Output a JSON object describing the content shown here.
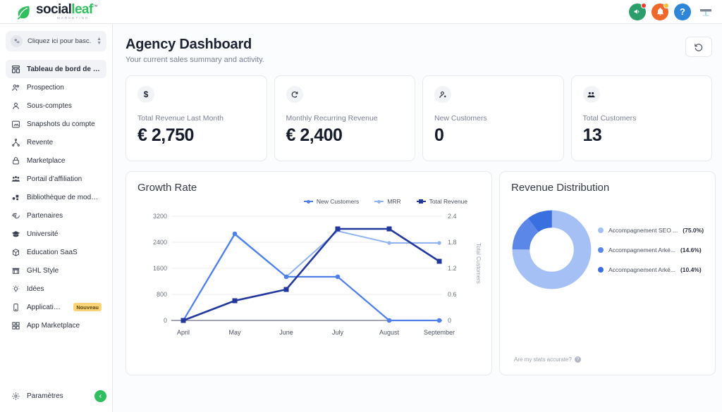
{
  "brand": {
    "name_part1": "social",
    "name_part2": "leaf",
    "tm": "™",
    "tagline": "MARKETING",
    "leaf_icon": "leaf-icon"
  },
  "topbar": {
    "icons": [
      {
        "name": "announcement-megaphone-icon",
        "badge": "red"
      },
      {
        "name": "notification-bell-icon",
        "badge": "yellow"
      },
      {
        "name": "help-question-icon",
        "label": "?"
      },
      {
        "name": "user-avatar",
        "label": ""
      }
    ]
  },
  "sidebar": {
    "switcher": {
      "icon": "switch-account-icon",
      "text": "Cliquez ici pour basc...",
      "stepper_icon": "chevron-updown-icon"
    },
    "items": [
      {
        "label": "Tableau de bord de l’Age...",
        "icon": "dashboard-icon",
        "active": true
      },
      {
        "label": "Prospection",
        "icon": "prospecting-users-icon",
        "active": false
      },
      {
        "label": "Sous-comptes",
        "icon": "subaccount-user-icon",
        "active": false
      },
      {
        "label": "Snapshots du compte",
        "icon": "snapshot-image-icon",
        "active": false
      },
      {
        "label": "Revente",
        "icon": "reseller-network-icon",
        "active": false
      },
      {
        "label": "Marketplace",
        "icon": "lock-marketplace-icon",
        "active": false
      },
      {
        "label": "Portail d’affiliation",
        "icon": "affiliate-group-icon",
        "active": false
      },
      {
        "label": "Bibliothèque de modèles",
        "icon": "template-library-icon",
        "active": false
      },
      {
        "label": "Partenaires",
        "icon": "partners-handshake-icon",
        "active": false
      },
      {
        "label": "Université",
        "icon": "graduation-cap-icon",
        "active": false
      },
      {
        "label": "Éducation SaaS",
        "icon": "saas-education-icon",
        "active": false
      },
      {
        "label": "GHL Style",
        "icon": "storefront-style-icon",
        "active": false
      },
      {
        "label": "Idées",
        "icon": "lightbulb-ideas-icon",
        "active": false
      },
      {
        "label": "Application ...",
        "icon": "mobile-app-icon",
        "active": false,
        "badge": "Nouveau"
      },
      {
        "label": "App Marketplace",
        "icon": "grid-apps-icon",
        "active": false
      }
    ],
    "settings": {
      "label": "Paramètres",
      "icon": "gear-icon"
    },
    "collapse": {
      "icon": "chevron-left-icon"
    }
  },
  "page": {
    "title": "Agency Dashboard",
    "subtitle": "Your current sales summary and activity.",
    "refresh_icon": "refresh-counterclockwise-icon"
  },
  "kpis": [
    {
      "icon": "dollar-sign-icon",
      "glyph": "$",
      "label": "Total Revenue Last Month",
      "value": "€ 2,750"
    },
    {
      "icon": "recurring-refresh-icon",
      "glyph": "↻",
      "label": "Monthly Recurring Revenue",
      "value": "€ 2,400"
    },
    {
      "icon": "user-plus-icon",
      "glyph": "",
      "label": "New Customers",
      "value": "0"
    },
    {
      "icon": "users-group-icon",
      "glyph": "",
      "label": "Total Customers",
      "value": "13"
    }
  ],
  "chart_data": [
    {
      "type": "line",
      "title": "Growth Rate",
      "xlabel": "",
      "ylabel": "",
      "y2label": "Total Customers",
      "categories": [
        "April",
        "May",
        "June",
        "July",
        "August",
        "September"
      ],
      "yticks": [
        "0",
        "800",
        "1600",
        "2400",
        "3200"
      ],
      "ylim": [
        0,
        3200
      ],
      "y2ticks": [
        "0",
        "0.6",
        "1.2",
        "1.8",
        "2.4"
      ],
      "y2lim": [
        0,
        2.4
      ],
      "grid": true,
      "legend_position": "top-right",
      "series": [
        {
          "name": "New Customers",
          "color": "#4f7fe8",
          "marker": "circle",
          "axis": "right",
          "values": [
            0,
            2.0,
            1.0,
            1.0,
            0,
            0
          ]
        },
        {
          "name": "MRR",
          "color": "#90b3f2",
          "marker": "circle",
          "axis": "left",
          "values": [
            0,
            2650,
            1350,
            2750,
            2400,
            2400
          ]
        },
        {
          "name": "Total Revenue",
          "color": "#22389c",
          "marker": "square",
          "axis": "left",
          "values": [
            0,
            600,
            950,
            2750,
            2750,
            1800
          ]
        }
      ]
    },
    {
      "type": "pie",
      "title": "Revenue Distribution",
      "donut": true,
      "labels": [
        "Accompagnement SEO ...",
        "Accompagnement Arké...",
        "Accompagnement Arké..."
      ],
      "percents": [
        "(75.0%)",
        "(14.6%)",
        "(10.4%)"
      ],
      "values": [
        75.0,
        14.6,
        10.4
      ],
      "colors": [
        "#a4c0f4",
        "#5b87e8",
        "#3a6fe0"
      ],
      "footnote": "Are my stats accurate?",
      "footnote_icon": "help-circle-icon"
    }
  ]
}
